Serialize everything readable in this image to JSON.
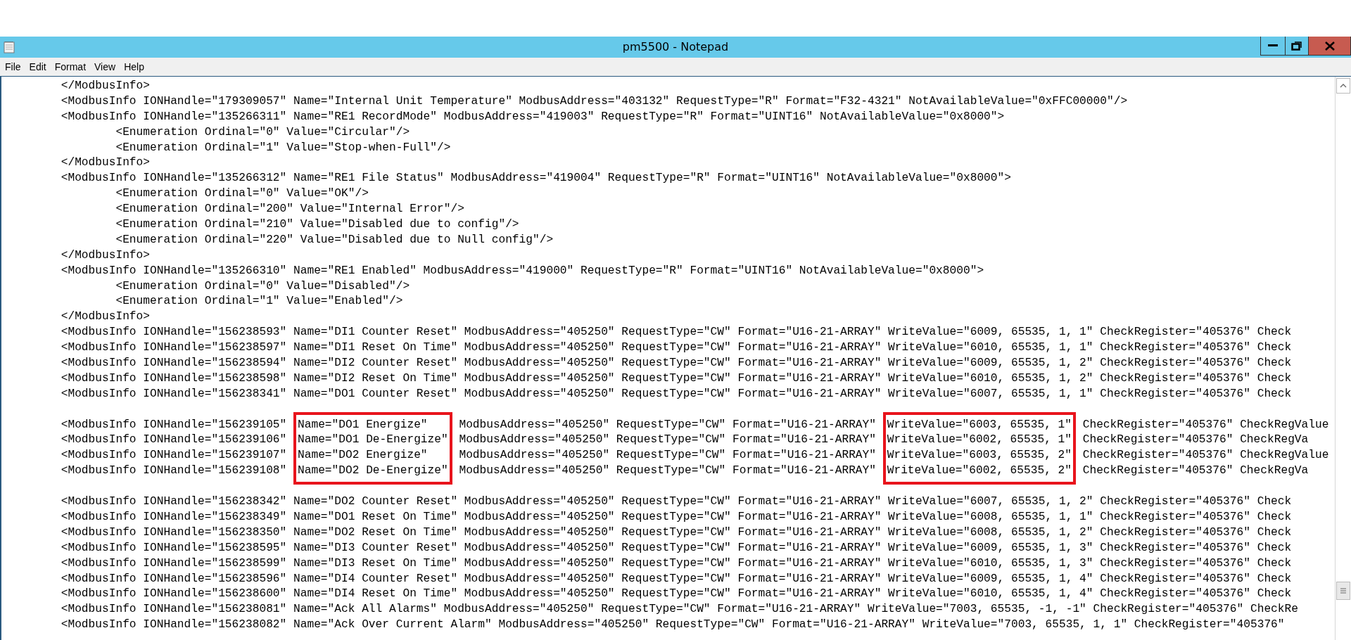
{
  "window": {
    "title": "pm5500 - Notepad"
  },
  "menu": [
    "File",
    "Edit",
    "Format",
    "View",
    "Help"
  ],
  "lines": [
    {
      "kind": "text",
      "text": "\t</ModbusInfo>"
    },
    {
      "kind": "text",
      "text": "\t<ModbusInfo IONHandle=\"179309057\" Name=\"Internal Unit Temperature\" ModbusAddress=\"403132\" RequestType=\"R\" Format=\"F32-4321\" NotAvailableValue=\"0xFFC00000\"/>"
    },
    {
      "kind": "text",
      "text": "\t<ModbusInfo IONHandle=\"135266311\" Name=\"RE1 RecordMode\" ModbusAddress=\"419003\" RequestType=\"R\" Format=\"UINT16\" NotAvailableValue=\"0x8000\">"
    },
    {
      "kind": "text",
      "text": "\t\t<Enumeration Ordinal=\"0\" Value=\"Circular\"/>"
    },
    {
      "kind": "text",
      "text": "\t\t<Enumeration Ordinal=\"1\" Value=\"Stop-when-Full\"/>"
    },
    {
      "kind": "text",
      "text": "\t</ModbusInfo>"
    },
    {
      "kind": "text",
      "text": "\t<ModbusInfo IONHandle=\"135266312\" Name=\"RE1 File Status\" ModbusAddress=\"419004\" RequestType=\"R\" Format=\"UINT16\" NotAvailableValue=\"0x8000\">"
    },
    {
      "kind": "text",
      "text": "\t\t<Enumeration Ordinal=\"0\" Value=\"OK\"/>"
    },
    {
      "kind": "text",
      "text": "\t\t<Enumeration Ordinal=\"200\" Value=\"Internal Error\"/>"
    },
    {
      "kind": "text",
      "text": "\t\t<Enumeration Ordinal=\"210\" Value=\"Disabled due to config\"/>"
    },
    {
      "kind": "text",
      "text": "\t\t<Enumeration Ordinal=\"220\" Value=\"Disabled due to Null config\"/>"
    },
    {
      "kind": "text",
      "text": "\t</ModbusInfo>"
    },
    {
      "kind": "text",
      "text": "\t<ModbusInfo IONHandle=\"135266310\" Name=\"RE1 Enabled\" ModbusAddress=\"419000\" RequestType=\"R\" Format=\"UINT16\" NotAvailableValue=\"0x8000\">"
    },
    {
      "kind": "text",
      "text": "\t\t<Enumeration Ordinal=\"0\" Value=\"Disabled\"/>"
    },
    {
      "kind": "text",
      "text": "\t\t<Enumeration Ordinal=\"1\" Value=\"Enabled\"/>"
    },
    {
      "kind": "text",
      "text": "\t</ModbusInfo>"
    },
    {
      "kind": "text",
      "text": "\t<ModbusInfo IONHandle=\"156238593\" Name=\"DI1 Counter Reset\" ModbusAddress=\"405250\" RequestType=\"CW\" Format=\"U16-21-ARRAY\" WriteValue=\"6009, 65535, 1, 1\" CheckRegister=\"405376\" Check"
    },
    {
      "kind": "text",
      "text": "\t<ModbusInfo IONHandle=\"156238597\" Name=\"DI1 Reset On Time\" ModbusAddress=\"405250\" RequestType=\"CW\" Format=\"U16-21-ARRAY\" WriteValue=\"6010, 65535, 1, 1\" CheckRegister=\"405376\" Check"
    },
    {
      "kind": "text",
      "text": "\t<ModbusInfo IONHandle=\"156238594\" Name=\"DI2 Counter Reset\" ModbusAddress=\"405250\" RequestType=\"CW\" Format=\"U16-21-ARRAY\" WriteValue=\"6009, 65535, 1, 2\" CheckRegister=\"405376\" Check"
    },
    {
      "kind": "text",
      "text": "\t<ModbusInfo IONHandle=\"156238598\" Name=\"DI2 Reset On Time\" ModbusAddress=\"405250\" RequestType=\"CW\" Format=\"U16-21-ARRAY\" WriteValue=\"6010, 65535, 1, 2\" CheckRegister=\"405376\" Check"
    },
    {
      "kind": "text",
      "text": "\t<ModbusInfo IONHandle=\"156238341\" Name=\"DO1 Counter Reset\" ModbusAddress=\"405250\" RequestType=\"CW\" Format=\"U16-21-ARRAY\" WriteValue=\"6007, 65535, 1, 1\" CheckRegister=\"405376\" Check"
    },
    {
      "kind": "blank"
    },
    {
      "kind": "boxed_group",
      "rows": [
        {
          "lead": "\t<ModbusInfo IONHandle=\"156239105\" ",
          "name": "Name=\"DO1 Energize\"",
          "middle": " ModbusAddress=\"405250\" RequestType=\"CW\" Format=\"U16-21-ARRAY\" ",
          "write": "WriteValue=\"6003, 65535, 1\"",
          "tail": " CheckRegister=\"405376\" CheckRegValue"
        },
        {
          "lead": "\t<ModbusInfo IONHandle=\"156239106\" ",
          "name": "Name=\"DO1 De-Energize\"",
          "middle": " ModbusAddress=\"405250\" RequestType=\"CW\" Format=\"U16-21-ARRAY\" ",
          "write": "WriteValue=\"6002, 65535, 1\"",
          "tail": " CheckRegister=\"405376\" CheckRegVa"
        },
        {
          "lead": "\t<ModbusInfo IONHandle=\"156239107\" ",
          "name": "Name=\"DO2 Energize\"",
          "middle": " ModbusAddress=\"405250\" RequestType=\"CW\" Format=\"U16-21-ARRAY\" ",
          "write": "WriteValue=\"6003, 65535, 2\"",
          "tail": " CheckRegister=\"405376\" CheckRegValue"
        },
        {
          "lead": "\t<ModbusInfo IONHandle=\"156239108\" ",
          "name": "Name=\"DO2 De-Energize\"",
          "middle": " ModbusAddress=\"405250\" RequestType=\"CW\" Format=\"U16-21-ARRAY\" ",
          "write": "WriteValue=\"6002, 65535, 2\"",
          "tail": " CheckRegister=\"405376\" CheckRegVa"
        }
      ]
    },
    {
      "kind": "blank"
    },
    {
      "kind": "text",
      "text": "\t<ModbusInfo IONHandle=\"156238342\" Name=\"DO2 Counter Reset\" ModbusAddress=\"405250\" RequestType=\"CW\" Format=\"U16-21-ARRAY\" WriteValue=\"6007, 65535, 1, 2\" CheckRegister=\"405376\" Check"
    },
    {
      "kind": "text",
      "text": "\t<ModbusInfo IONHandle=\"156238349\" Name=\"DO1 Reset On Time\" ModbusAddress=\"405250\" RequestType=\"CW\" Format=\"U16-21-ARRAY\" WriteValue=\"6008, 65535, 1, 1\" CheckRegister=\"405376\" Check"
    },
    {
      "kind": "text",
      "text": "\t<ModbusInfo IONHandle=\"156238350\" Name=\"DO2 Reset On Time\" ModbusAddress=\"405250\" RequestType=\"CW\" Format=\"U16-21-ARRAY\" WriteValue=\"6008, 65535, 1, 2\" CheckRegister=\"405376\" Check"
    },
    {
      "kind": "text",
      "text": "\t<ModbusInfo IONHandle=\"156238595\" Name=\"DI3 Counter Reset\" ModbusAddress=\"405250\" RequestType=\"CW\" Format=\"U16-21-ARRAY\" WriteValue=\"6009, 65535, 1, 3\" CheckRegister=\"405376\" Check"
    },
    {
      "kind": "text",
      "text": "\t<ModbusInfo IONHandle=\"156238599\" Name=\"DI3 Reset On Time\" ModbusAddress=\"405250\" RequestType=\"CW\" Format=\"U16-21-ARRAY\" WriteValue=\"6010, 65535, 1, 3\" CheckRegister=\"405376\" Check"
    },
    {
      "kind": "text",
      "text": "\t<ModbusInfo IONHandle=\"156238596\" Name=\"DI4 Counter Reset\" ModbusAddress=\"405250\" RequestType=\"CW\" Format=\"U16-21-ARRAY\" WriteValue=\"6009, 65535, 1, 4\" CheckRegister=\"405376\" Check"
    },
    {
      "kind": "text",
      "text": "\t<ModbusInfo IONHandle=\"156238600\" Name=\"DI4 Reset On Time\" ModbusAddress=\"405250\" RequestType=\"CW\" Format=\"U16-21-ARRAY\" WriteValue=\"6010, 65535, 1, 4\" CheckRegister=\"405376\" Check"
    },
    {
      "kind": "text",
      "text": "\t<ModbusInfo IONHandle=\"156238081\" Name=\"Ack All Alarms\" ModbusAddress=\"405250\" RequestType=\"CW\" Format=\"U16-21-ARRAY\" WriteValue=\"7003, 65535, -1, -1\" CheckRegister=\"405376\" CheckRe"
    },
    {
      "kind": "text",
      "text": "\t<ModbusInfo IONHandle=\"156238082\" Name=\"Ack Over Current Alarm\" ModbusAddress=\"405250\" RequestType=\"CW\" Format=\"U16-21-ARRAY\" WriteValue=\"7003, 65535, 1, 1\" CheckRegister=\"405376\""
    }
  ]
}
